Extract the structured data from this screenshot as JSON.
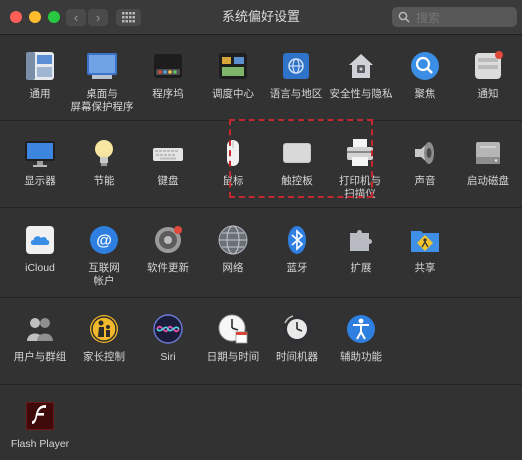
{
  "window": {
    "title": "系统偏好设置"
  },
  "search": {
    "placeholder": "搜索"
  },
  "rows": [
    [
      {
        "name": "general",
        "label": "通用"
      },
      {
        "name": "desktop",
        "label": "桌面与\n屏幕保护程序"
      },
      {
        "name": "dock",
        "label": "程序坞"
      },
      {
        "name": "mission-control",
        "label": "调度中心"
      },
      {
        "name": "language-region",
        "label": "语言与地区"
      },
      {
        "name": "security-privacy",
        "label": "安全性与隐私"
      },
      {
        "name": "spotlight",
        "label": "聚焦"
      },
      {
        "name": "notifications",
        "label": "通知"
      }
    ],
    [
      {
        "name": "displays",
        "label": "显示器"
      },
      {
        "name": "energy-saver",
        "label": "节能"
      },
      {
        "name": "keyboard",
        "label": "键盘"
      },
      {
        "name": "mouse",
        "label": "鼠标"
      },
      {
        "name": "trackpad",
        "label": "触控板"
      },
      {
        "name": "printers-scanners",
        "label": "打印机与\n扫描仪"
      },
      {
        "name": "sound",
        "label": "声音"
      },
      {
        "name": "startup-disk",
        "label": "启动磁盘"
      }
    ],
    [
      {
        "name": "icloud",
        "label": "iCloud"
      },
      {
        "name": "internet-accounts",
        "label": "互联网\n帐户"
      },
      {
        "name": "software-update",
        "label": "软件更新"
      },
      {
        "name": "network",
        "label": "网络"
      },
      {
        "name": "bluetooth",
        "label": "蓝牙"
      },
      {
        "name": "extensions",
        "label": "扩展"
      },
      {
        "name": "sharing",
        "label": "共享"
      }
    ],
    [
      {
        "name": "users-groups",
        "label": "用户与群组"
      },
      {
        "name": "parental-controls",
        "label": "家长控制"
      },
      {
        "name": "siri",
        "label": "Siri"
      },
      {
        "name": "date-time",
        "label": "日期与时间"
      },
      {
        "name": "time-machine",
        "label": "时间机器"
      },
      {
        "name": "accessibility",
        "label": "辅助功能"
      }
    ],
    [
      {
        "name": "flash-player",
        "label": "Flash Player"
      }
    ]
  ]
}
